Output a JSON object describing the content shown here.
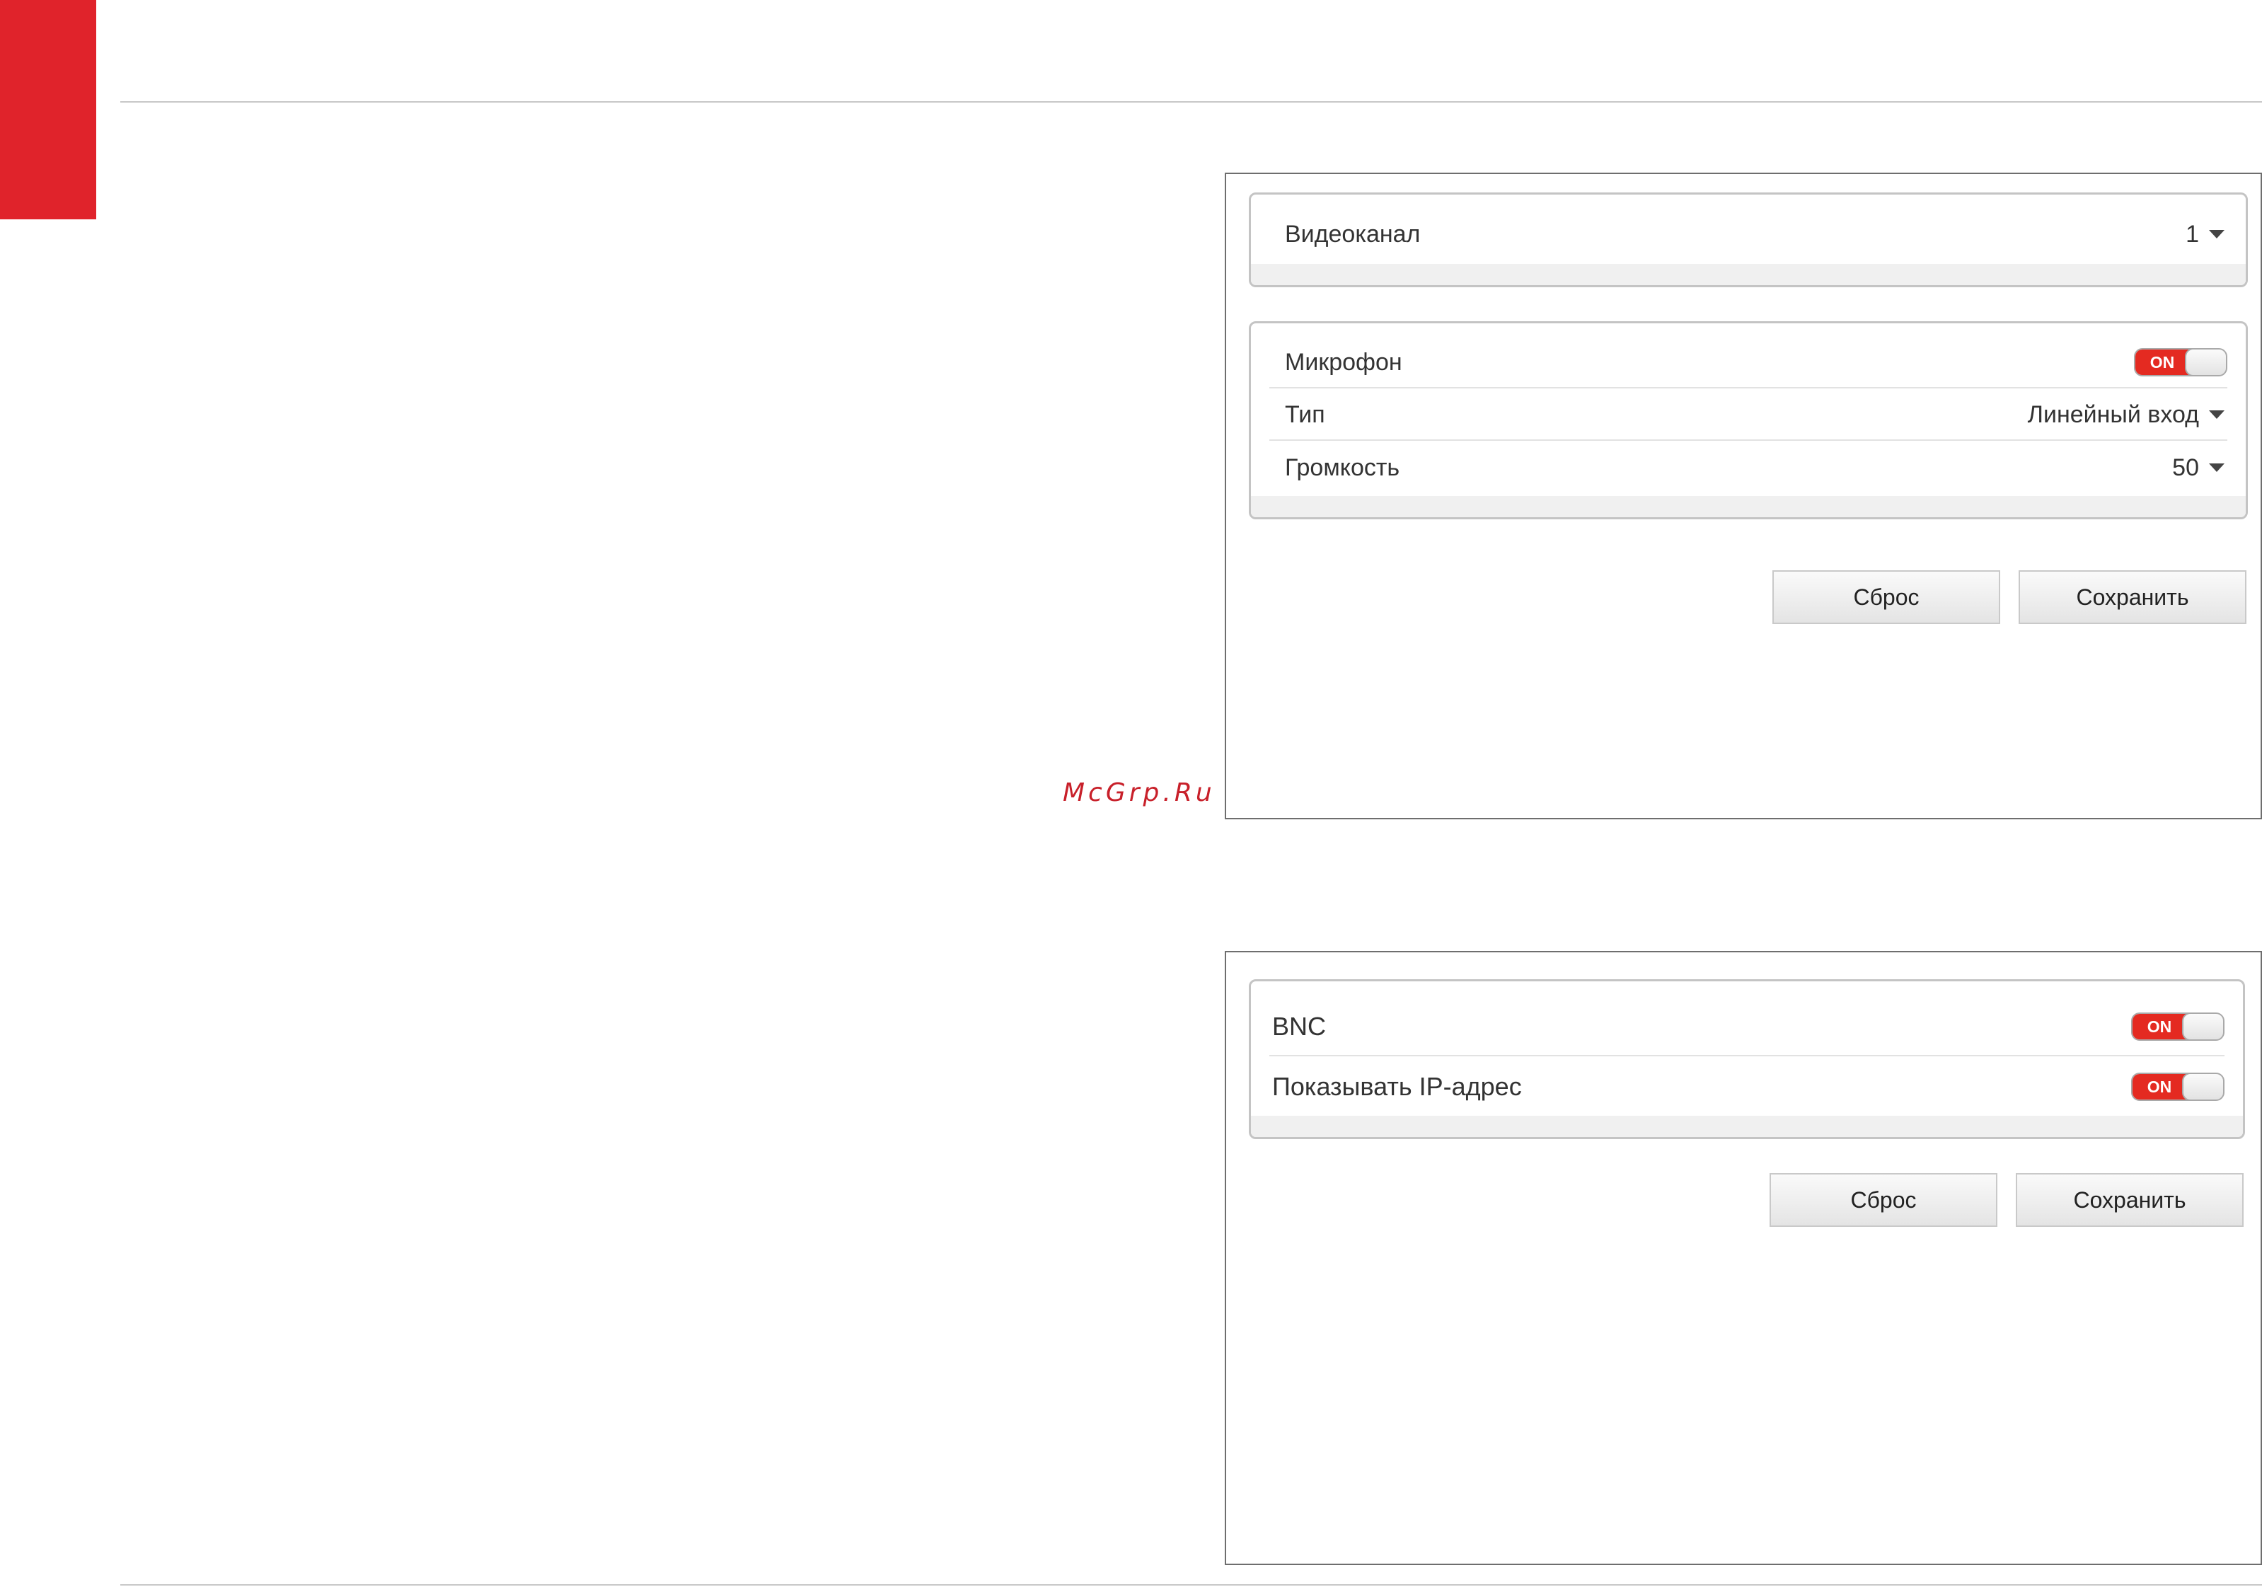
{
  "watermark": "McGrp.Ru",
  "panel_audio": {
    "videochannel": {
      "label": "Видеоканал",
      "value": "1"
    },
    "microphone": {
      "label": "Микрофон",
      "toggle": "ON"
    },
    "type": {
      "label": "Тип",
      "value": "Линейный вход"
    },
    "volume": {
      "label": "Громкость",
      "value": "50"
    },
    "reset_label": "Сброс",
    "save_label": "Сохранить"
  },
  "panel_video_out": {
    "bnc": {
      "label": "BNC",
      "toggle": "ON"
    },
    "show_ip": {
      "label": "Показывать IP-адрес",
      "toggle": "ON"
    },
    "reset_label": "Сброс",
    "save_label": "Сохранить"
  },
  "colors": {
    "accent": "#e0232b",
    "toggle_on": "#e42a21"
  }
}
